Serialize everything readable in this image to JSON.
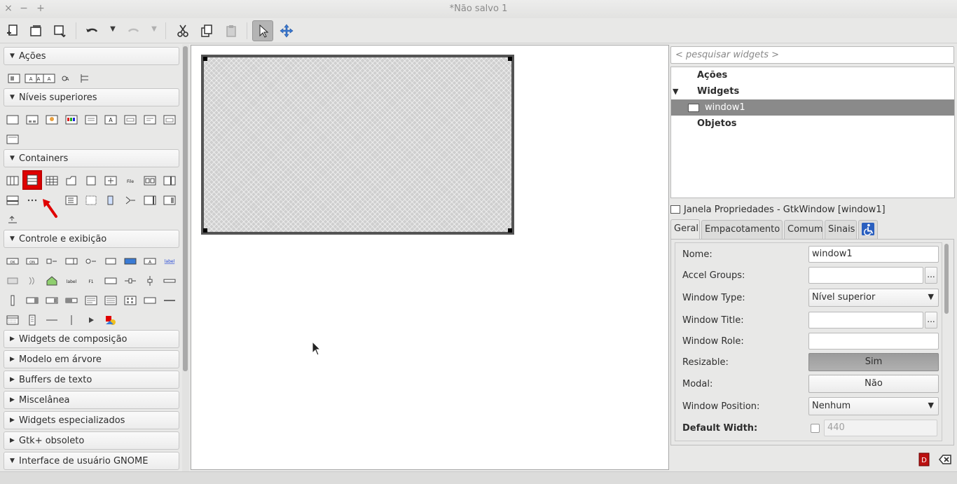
{
  "window": {
    "title": "*Não salvo 1",
    "controls": [
      "×",
      "−",
      "+"
    ]
  },
  "toolbar": {
    "buttons": [
      "new-icon",
      "open-icon",
      "save-icon",
      "undo-icon",
      "redo-icon",
      "cut-icon",
      "copy-icon",
      "paste-icon",
      "pointer-icon",
      "drag-resize-icon"
    ]
  },
  "palette": {
    "groups": [
      {
        "label": "Ações",
        "expanded": true
      },
      {
        "label": "Níveis superiores",
        "expanded": true
      },
      {
        "label": "Containers",
        "expanded": true
      },
      {
        "label": "Controle e exibição",
        "expanded": true
      },
      {
        "label": "Widgets de composição",
        "expanded": false
      },
      {
        "label": "Modelo em árvore",
        "expanded": false
      },
      {
        "label": "Buffers de texto",
        "expanded": false
      },
      {
        "label": "Miscelânea",
        "expanded": false
      },
      {
        "label": "Widgets especializados",
        "expanded": false
      },
      {
        "label": "Gtk+ obsoleto",
        "expanded": false
      },
      {
        "label": "Interface de usuário GNOME",
        "expanded": true
      }
    ],
    "icon_labels": {
      "file": "File",
      "label1": "label",
      "label2": "label",
      "ok": "OK",
      "on": "ON",
      "f1": "F1"
    },
    "selected_widget": "vertical-box-icon",
    "annotation": "red-arrow-icon"
  },
  "right": {
    "search_placeholder": "< pesquisar widgets >",
    "tree": [
      {
        "label": "Ações",
        "bold": true
      },
      {
        "label": "Widgets",
        "bold": true,
        "expander": "▼"
      },
      {
        "label": "window1",
        "bold": false,
        "selected": true
      },
      {
        "label": "Objetos",
        "bold": true
      }
    ],
    "props_title": "Janela Propriedades - GtkWindow [window1]",
    "tabs": [
      "Geral",
      "Empacotamento",
      "Comum",
      "Sinais"
    ],
    "active_tab": "Geral",
    "props": {
      "name_label": "Nome:",
      "name_value": "window1",
      "accel_label": "Accel Groups:",
      "type_label": "Window Type:",
      "type_value": "Nível superior",
      "wtitle_label": "Window Title:",
      "role_label": "Window Role:",
      "resizable_label": "Resizable:",
      "resizable_value": "Sim",
      "modal_label": "Modal:",
      "modal_value": "Não",
      "position_label": "Window Position:",
      "position_value": "Nenhum",
      "width_label": "Default Width:",
      "width_value": "440",
      "dots": "...",
      "combo_arrow": "▼"
    }
  },
  "colors": {
    "selection_highlight": "#e00000",
    "annotation_arrow": "#e00000",
    "tree_selection": "#8a8a8a"
  }
}
